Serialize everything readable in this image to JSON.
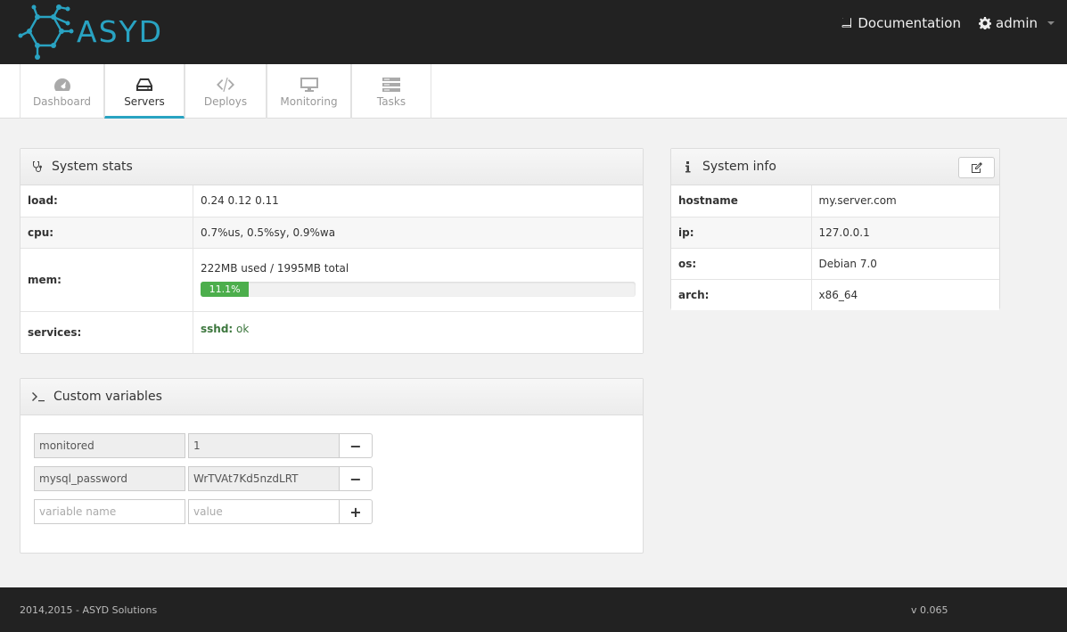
{
  "brand": {
    "name": "ASYD",
    "accent": "#29a3c2"
  },
  "top_nav": {
    "documentation": "Documentation",
    "user": "admin"
  },
  "tabs": [
    {
      "label": "Dashboard",
      "icon": "dashboard-icon"
    },
    {
      "label": "Servers",
      "icon": "server-icon",
      "active": true
    },
    {
      "label": "Deploys",
      "icon": "code-icon"
    },
    {
      "label": "Monitoring",
      "icon": "monitor-icon"
    },
    {
      "label": "Tasks",
      "icon": "tasks-icon"
    }
  ],
  "system_stats": {
    "title": "System stats",
    "load_label": "load:",
    "load_value": "0.24 0.12 0.11",
    "cpu_label": "cpu:",
    "cpu_value": "0.7%us, 0.5%sy, 0.9%wa",
    "mem_label": "mem:",
    "mem_value": "222MB used / 1995MB total",
    "mem_percent_label": "11.1%",
    "mem_percent": 11.1,
    "services_label": "services:",
    "service_name": "sshd:",
    "service_status": "ok"
  },
  "system_info": {
    "title": "System info",
    "rows": [
      {
        "key": "hostname",
        "value": "my.server.com"
      },
      {
        "key": "ip:",
        "value": "127.0.0.1"
      },
      {
        "key": "os:",
        "value": "Debian 7.0"
      },
      {
        "key": "arch:",
        "value": "x86_64"
      }
    ]
  },
  "custom_variables": {
    "title": "Custom variables",
    "vars": [
      {
        "name": "monitored",
        "value": "1"
      },
      {
        "name": "mysql_password",
        "value": "WrTVAt7Kd5nzdLRT"
      }
    ],
    "new_name_placeholder": "variable name",
    "new_value_placeholder": "value",
    "remove_label": "−",
    "add_label": "+"
  },
  "footer": {
    "copyright": "2014,2015 - ASYD Solutions",
    "version": "v 0.065"
  }
}
